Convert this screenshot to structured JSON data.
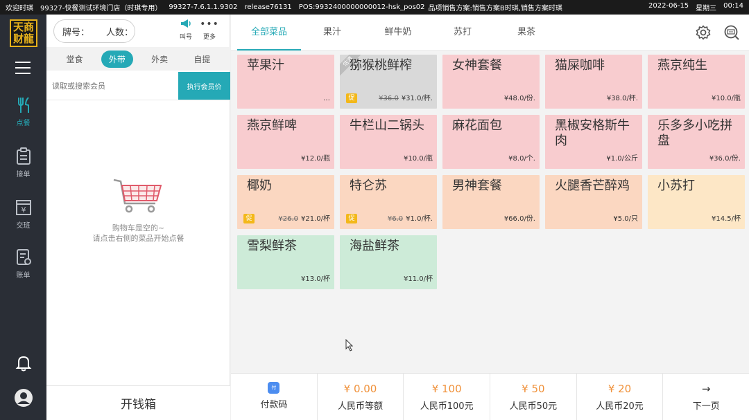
{
  "status_bar": {
    "welcome": "欢迎时琪",
    "store": "99327-快餐测试环境门店（时琪专用）",
    "version": "99327-7.6.1.1.9302",
    "release": "release76131",
    "pos": "POS:9932400000000012-hsk_pos02",
    "sales_plan": "品项销售方案:销售方案B时琪,销售方案时琪",
    "date": "2022-06-15",
    "weekday": "星期三",
    "time": "00:14"
  },
  "logo_text": "天商财龍",
  "nav": {
    "items": [
      {
        "label": "点餐",
        "icon": "utensils-icon",
        "active": true
      },
      {
        "label": "接单",
        "icon": "clipboard-icon",
        "active": false
      },
      {
        "label": "交班",
        "icon": "yen-box-icon",
        "active": false
      },
      {
        "label": "账单",
        "icon": "bill-icon",
        "active": false
      }
    ]
  },
  "cart": {
    "table_label": "牌号：",
    "people_label": "人数：",
    "call_label": "叫号",
    "more_label": "更多",
    "modes": [
      "堂食",
      "外带",
      "外卖",
      "自提"
    ],
    "active_mode": "外带",
    "member_placeholder": "读取或搜索会员",
    "member_price_button": "执行会员价",
    "empty_line1": "购物车是空的~",
    "empty_line2": "请点击右侧的菜品开始点餐",
    "cashbox": "开钱箱"
  },
  "categories": [
    "全部菜品",
    "果汁",
    "鲜牛奶",
    "苏打",
    "果茶"
  ],
  "active_category": "全部菜品",
  "dishes": [
    {
      "name": "苹果汁",
      "price": "…",
      "color": "#f8cccf"
    },
    {
      "name": "猕猴桃鲜榨",
      "original": "¥36.0",
      "price": "¥31.0/杯.",
      "promo": "促",
      "badge": "估清",
      "color": "#d9d9d9"
    },
    {
      "name": "女神套餐",
      "price": "¥48.0/份.",
      "color": "#f8cccf"
    },
    {
      "name": "猫屎咖啡",
      "price": "¥38.0/杯.",
      "color": "#f8cccf"
    },
    {
      "name": "燕京纯生",
      "price": "¥10.0/瓶",
      "color": "#f8cccf"
    },
    {
      "name": "燕京鲜啤",
      "price": "¥12.0/瓶",
      "color": "#f8cccf"
    },
    {
      "name": "牛栏山二锅头",
      "price": "¥10.0/瓶",
      "color": "#f8cccf"
    },
    {
      "name": "麻花面包",
      "price": "¥8.0/个.",
      "color": "#f8cccf"
    },
    {
      "name": "黑椒安格斯牛肉",
      "price": "¥1.0/公斤",
      "color": "#f8cccf"
    },
    {
      "name": "乐多多小吃拼盘",
      "price": "¥36.0/份.",
      "color": "#f8cccf"
    },
    {
      "name": "椰奶",
      "original": "¥26.0",
      "price": "¥21.0/杯",
      "promo": "促",
      "color": "#fbd7c1"
    },
    {
      "name": "特仑苏",
      "original": "¥6.0",
      "price": "¥1.0/杯.",
      "promo": "促",
      "color": "#fbd7c1"
    },
    {
      "name": "男神套餐",
      "price": "¥66.0/份.",
      "color": "#fbd7c1"
    },
    {
      "name": "火腿香芒醉鸡",
      "price": "¥5.0/只",
      "color": "#fbd7c1"
    },
    {
      "name": "小苏打",
      "price": "¥14.5/杯",
      "color": "#fde7c6"
    },
    {
      "name": "雪梨鲜茶",
      "price": "¥13.0/杯",
      "color": "#cdebd8"
    },
    {
      "name": "海盐鲜茶",
      "price": "¥11.0/杯",
      "color": "#cdebd8"
    }
  ],
  "payments": [
    {
      "amount": "",
      "label": "付款码",
      "icon": "qr-pay-icon",
      "icon_text": "付"
    },
    {
      "amount": "¥ 0.00",
      "label": "人民币等额"
    },
    {
      "amount": "¥ 100",
      "label": "人民币100元"
    },
    {
      "amount": "¥ 50",
      "label": "人民币50元"
    },
    {
      "amount": "¥ 20",
      "label": "人民币20元"
    },
    {
      "amount": "",
      "label": "下一页",
      "icon": "arrow-right-icon",
      "icon_text": "→"
    }
  ],
  "accent_color": "#25a9b6",
  "price_color": "#f0913a"
}
